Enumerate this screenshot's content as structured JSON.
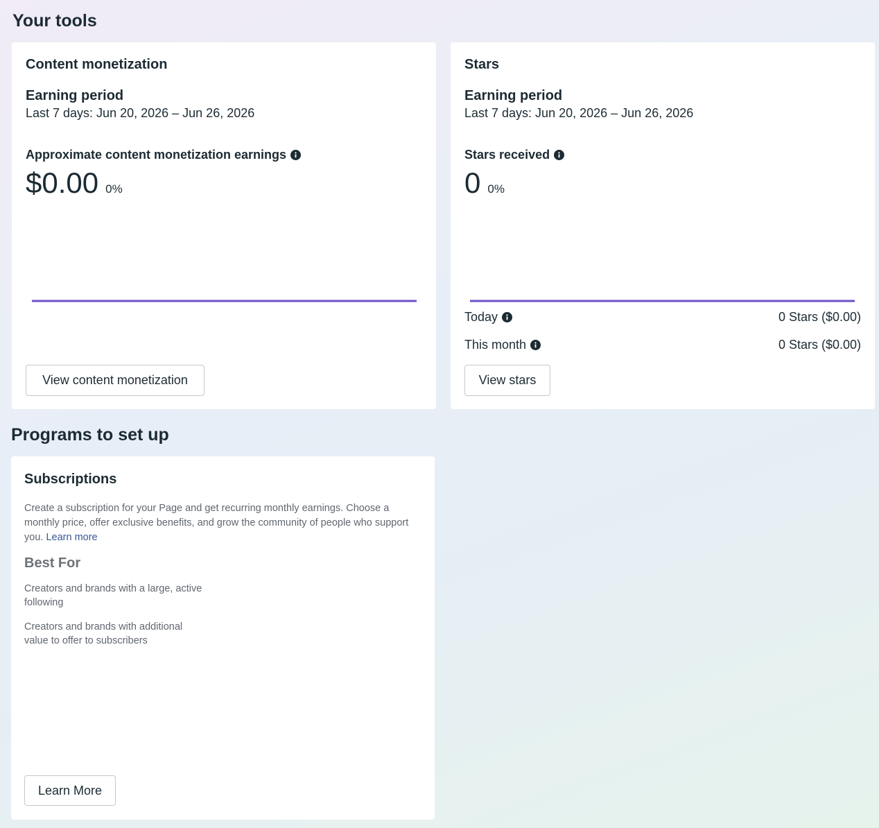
{
  "tools": {
    "section_title": "Your tools",
    "content_monetization": {
      "title": "Content monetization",
      "earning_period_label": "Earning period",
      "earning_period_range": "Last 7 days: Jun 20, 2026 – Jun 26, 2026",
      "metric_label": "Approximate content monetization earnings",
      "metric_value": "$0.00",
      "metric_delta": "0%",
      "button_label": "View content monetization"
    },
    "stars": {
      "title": "Stars",
      "earning_period_label": "Earning period",
      "earning_period_range": "Last 7 days: Jun 20, 2026 – Jun 26, 2026",
      "metric_label": "Stars received",
      "metric_value": "0",
      "metric_delta": "0%",
      "today_label": "Today",
      "today_value": "0 Stars ($0.00)",
      "month_label": "This month",
      "month_value": "0 Stars ($0.00)",
      "button_label": "View stars"
    }
  },
  "programs": {
    "section_title": "Programs to set up",
    "subscriptions": {
      "title": "Subscriptions",
      "description": "Create a subscription for your Page and get recurring monthly earnings. Choose a monthly price, offer exclusive benefits, and grow the community of people who support you.",
      "learn_more_link": "Learn more",
      "best_for_title": "Best For",
      "best_for_items": [
        "Creators and brands with a large, active following",
        "Creators and brands with additional value to offer to subscribers"
      ],
      "button_label": "Learn More"
    }
  },
  "colors": {
    "chart_line": "#6b4fc9",
    "link": "#385898",
    "card_bg": "#ffffff"
  },
  "icons": {
    "info": "info-icon"
  }
}
